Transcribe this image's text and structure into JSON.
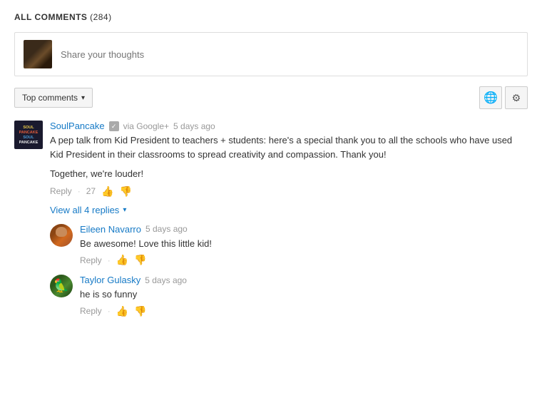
{
  "header": {
    "title": "ALL COMMENTS",
    "count": "(284)"
  },
  "share_input": {
    "placeholder": "Share your thoughts"
  },
  "controls": {
    "sort_label": "Top comments",
    "sort_arrow": "▾",
    "globe_icon": "🌐",
    "link_icon": "🔗"
  },
  "comments": [
    {
      "id": "soulpancake",
      "author": "SoulPancake",
      "verified": true,
      "via": "via Google+",
      "time": "5 days ago",
      "text_lines": [
        "A pep talk from Kid President to teachers + students: here's a special thank you to all the schools who have used Kid President in their classrooms to spread creativity and compassion. Thank you!",
        "Together, we're louder!"
      ],
      "reply_label": "Reply",
      "vote_count": "27",
      "view_replies_label": "View all 4 replies",
      "replies": [
        {
          "id": "eileen",
          "author": "Eileen Navarro",
          "time": "5 days ago",
          "text": "Be awesome! Love this little kid!",
          "reply_label": "Reply"
        },
        {
          "id": "taylor",
          "author": "Taylor Gulasky",
          "time": "5 days ago",
          "text": "he is so funny",
          "reply_label": "Reply"
        }
      ]
    }
  ]
}
